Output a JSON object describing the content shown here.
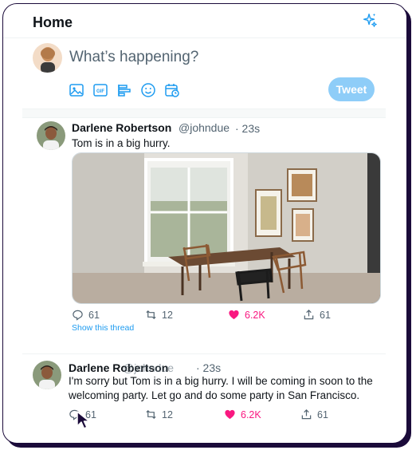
{
  "header": {
    "title": "Home",
    "sparkle_icon": "sparkle-icon"
  },
  "composer": {
    "placeholder": "What’s happening?",
    "tools": [
      "image-icon",
      "gif-icon",
      "poll-icon",
      "emoji-icon",
      "schedule-icon"
    ],
    "tweet_label": "Tweet"
  },
  "tweets": [
    {
      "name": "Darlene Robertson",
      "handle": "@johndue",
      "time": "· 23s",
      "text": "Tom is in a big hurry.",
      "actions": {
        "reply": "61",
        "retweet": "12",
        "like": "6.2K",
        "share": "61"
      },
      "thread_link": "Show this thread"
    },
    {
      "name": "Darlene Robertson",
      "handle": "@johndue",
      "time": "· 23s",
      "text_line1": "I'm sorry but Tom is in a big hurry. I will be coming in soon to the",
      "text_line2": "welcoming party. Let go and do some party in San Francisco.",
      "actions": {
        "reply": "61",
        "retweet": "12",
        "like": "6.2K",
        "share": "61"
      }
    }
  ],
  "colors": {
    "accent": "#1d9bf0",
    "like": "#f91880",
    "tweet_button": "#8ecdf8",
    "frame": "#1b0b3a"
  }
}
